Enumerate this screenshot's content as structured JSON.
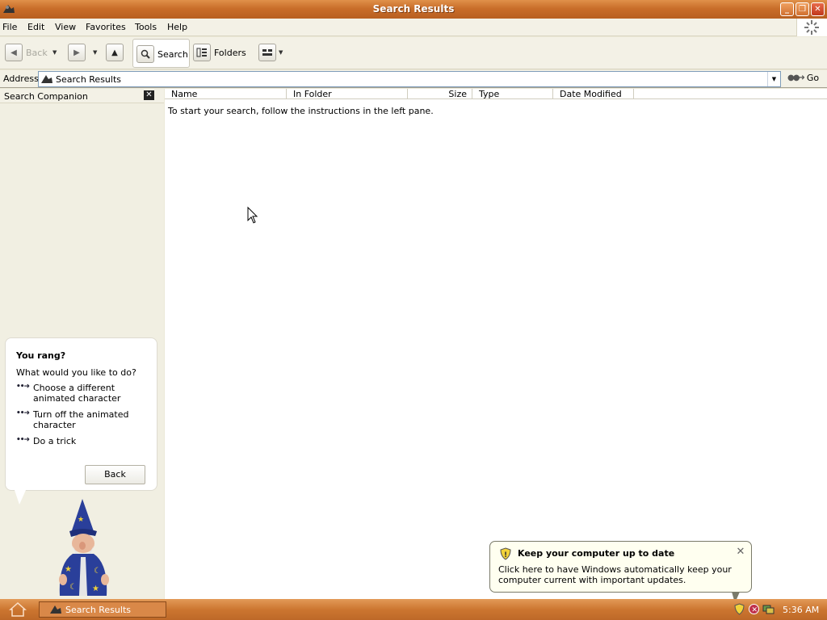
{
  "window": {
    "title": "Search Results",
    "buttons": {
      "minimize": "_",
      "maximize": "❐",
      "close": "✕"
    }
  },
  "menu": [
    "File",
    "Edit",
    "View",
    "Favorites",
    "Tools",
    "Help"
  ],
  "toolbar": {
    "back_label": "Back",
    "search_label": "Search",
    "folders_label": "Folders"
  },
  "address": {
    "label": "Address",
    "value": "Search Results",
    "go_label": "Go"
  },
  "left_pane": {
    "title": "Search Companion",
    "assistant": {
      "heading": "You rang?",
      "prompt": "What would you like to do?",
      "options": [
        "Choose a different animated character",
        "Turn off the animated character",
        "Do a trick"
      ],
      "back_button": "Back"
    }
  },
  "results": {
    "columns": [
      "Name",
      "In Folder",
      "Size",
      "Type",
      "Date Modified"
    ],
    "empty_message": "To start your search, follow the instructions in the left pane."
  },
  "notification": {
    "title": "Keep your computer up to date",
    "body": "Click here to have Windows automatically keep your computer current with important updates."
  },
  "taskbar": {
    "task": "Search Results",
    "clock": "5:36 AM"
  },
  "icons": {
    "app": "search-window-icon",
    "back": "back-arrow-icon",
    "forward": "forward-arrow-icon",
    "up": "up-folder-icon",
    "search": "magnifier-icon",
    "folders": "folders-icon",
    "views": "views-icon",
    "go": "go-arrow-icon",
    "wizard": "merlin-wizard-character",
    "shield": "security-shield-icon",
    "throbber": "loading-spinner-icon"
  },
  "colors": {
    "titlebar": "#c96e2a",
    "taskbar": "#cc7630",
    "toolbar": "#f3f1e6",
    "pane": "#f1efe2"
  }
}
